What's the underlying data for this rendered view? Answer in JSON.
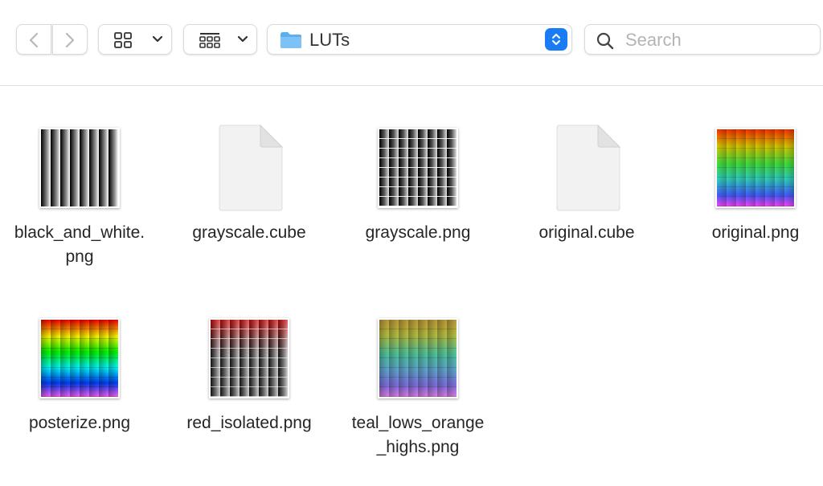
{
  "toolbar": {
    "back_icon": "chevron-left-icon",
    "forward_icon": "chevron-right-icon",
    "view_icon": "grid-view-icon",
    "group_icon": "group-icon",
    "path": {
      "label": "LUTs",
      "icon": "folder-icon"
    },
    "search": {
      "placeholder": "Search",
      "value": ""
    }
  },
  "files": [
    {
      "name": "black_and_white.\npng",
      "kind": "image"
    },
    {
      "name": "grayscale.cube",
      "kind": "document"
    },
    {
      "name": "grayscale.png",
      "kind": "image"
    },
    {
      "name": "original.cube",
      "kind": "document"
    },
    {
      "name": "original.png",
      "kind": "image"
    },
    {
      "name": "posterize.png",
      "kind": "image"
    },
    {
      "name": "red_isolated.png",
      "kind": "image"
    },
    {
      "name": "teal_lows_orange\n_highs.png",
      "kind": "image"
    }
  ],
  "colors": {
    "accent": "#1a7cf5",
    "folder": "#5aaff0"
  }
}
